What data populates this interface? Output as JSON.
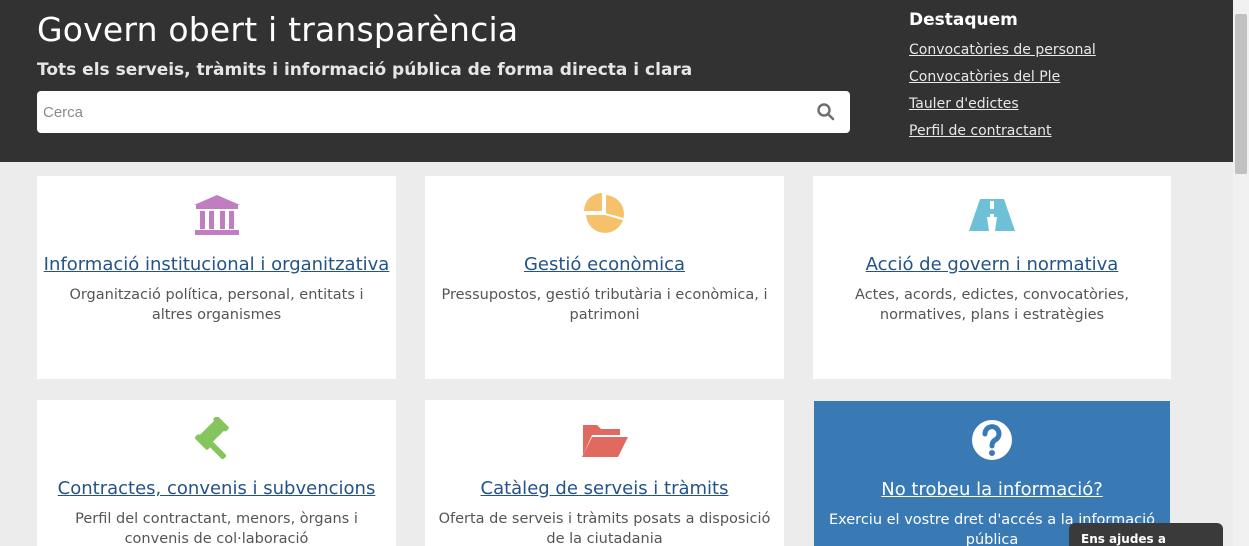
{
  "header": {
    "title": "Govern obert i transparència",
    "subtitle": "Tots els serveis, tràmits i informació pública de forma directa i clara",
    "search_placeholder": "Cerca"
  },
  "featured": {
    "title": "Destaquem",
    "links": [
      "Convocatòries de personal",
      "Convocatòries del Ple",
      "Tauler d'edictes",
      "Perfil de contractant"
    ]
  },
  "cards": [
    {
      "title": "Informació institucional i organitzativa",
      "desc": "Organització política, personal, entitats i altres organismes",
      "icon": "institution-icon",
      "color": "#c07ec0"
    },
    {
      "title": "Gestió econòmica",
      "desc": "Pressupostos, gestió tributària i econòmica, i patrimoni",
      "icon": "pie-chart-icon",
      "color": "#f5c26b"
    },
    {
      "title": "Acció de govern i normativa",
      "desc": "Actes, acords, edictes, convocatòries, normatives, plans i estratègies",
      "icon": "road-icon",
      "color": "#6ec0d6"
    },
    {
      "title": "Contractes, convenis i subvencions",
      "desc": "Perfil del contractant, menors, òrgans i convenis de col·laboració",
      "icon": "gavel-icon",
      "color": "#86c55e"
    },
    {
      "title": "Catàleg de serveis i tràmits",
      "desc": "Oferta de serveis i tràmits posats a disposició de la ciutadania",
      "icon": "folder-open-icon",
      "color": "#e06a5f"
    },
    {
      "title": "No trobeu la informació?",
      "desc": "Exerciu el vostre dret d'accés a la informació pública",
      "icon": "question-icon",
      "color": "#ffffff"
    }
  ],
  "feedback": {
    "label": "Ens ajudes a millorar?"
  }
}
